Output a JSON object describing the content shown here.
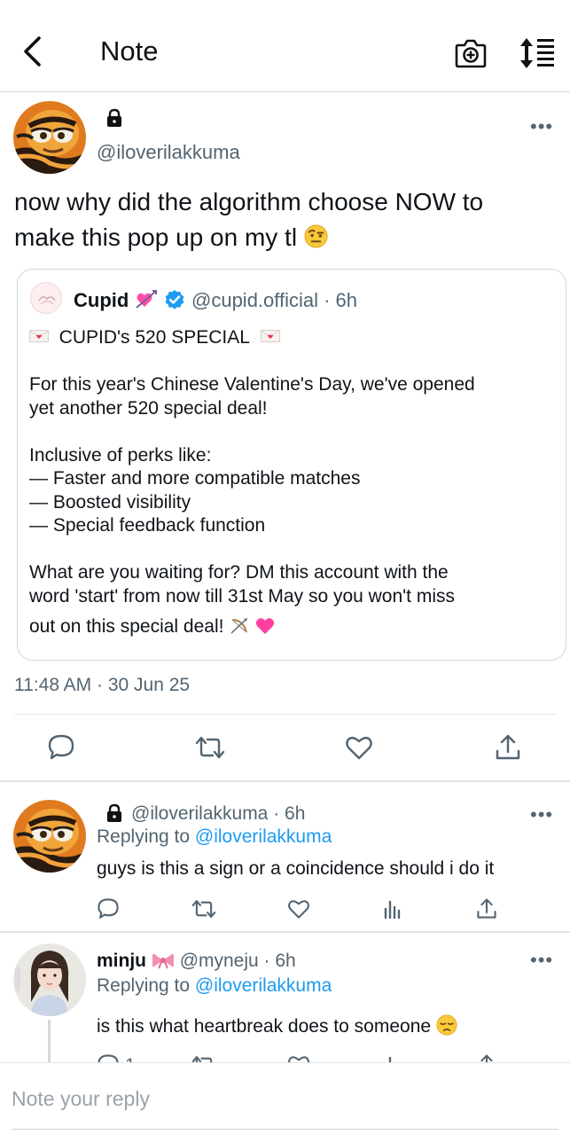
{
  "header": {
    "title": "Note",
    "icons": [
      "back-arrow-icon",
      "camera-icon",
      "sort-icon"
    ]
  },
  "post": {
    "handle": "@iloverilakkuma",
    "text": "now why did the algorithm choose NOW to make this pop up on my tl",
    "timestamp": "11:48 AM · 30 Jun 25",
    "quote": {
      "name": "Cupid",
      "handle_time": "@cupid.official · 6h",
      "title": "CUPID's 520 SPECIAL",
      "line1": "For this year's Chinese Valentine's Day, we've opened",
      "line2": "yet another 520 special deal!",
      "perks_title": "Inclusive of perks like:",
      "perk1": "— Faster and more compatible matches",
      "perk2": "— Boosted visibility",
      "perk3": "— Special feedback function",
      "cta1": "What are you waiting for? DM this account with the",
      "cta2": "word 'start' from now till 31st May so you won't miss",
      "cta3": "out on this special deal!"
    }
  },
  "replies": [
    {
      "handle_time": "@iloverilakkuma · 6h",
      "replying_label": "Replying to",
      "replying_to": "@iloverilakkuma",
      "text": "guys is this a sign or a coincidence should i do it"
    },
    {
      "name": "minju",
      "handle_time": "@myneju · 6h",
      "replying_label": "Replying to",
      "replying_to": "@iloverilakkuma",
      "text": "is this what heartbreak does to someone",
      "reply_count": "1"
    }
  ],
  "compose": {
    "placeholder": "Note your reply"
  },
  "colors": {
    "link": "#1d9bf0",
    "secondary": "#536471",
    "verified": "#1d9bf0",
    "heart_pink": "#ff4da6"
  }
}
